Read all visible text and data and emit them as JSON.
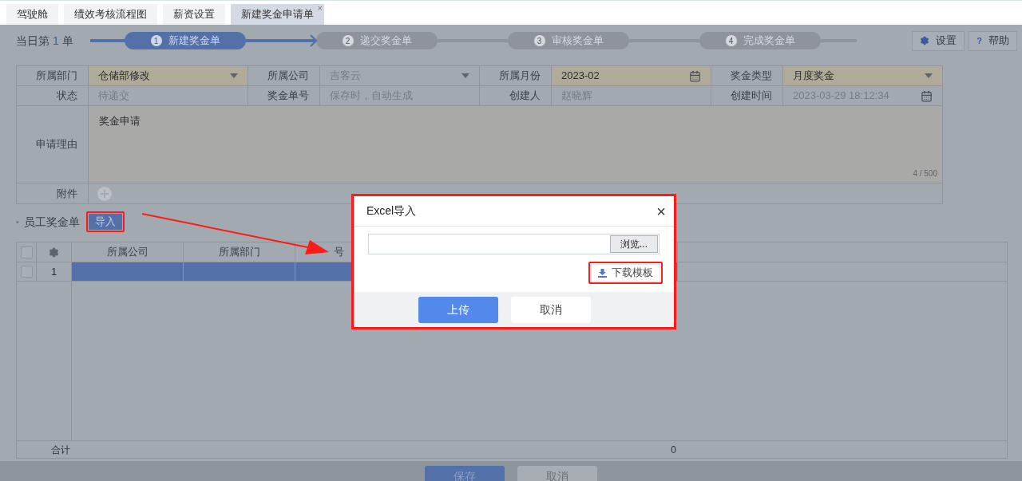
{
  "tabs": [
    {
      "label": "驾驶舱",
      "selected": false
    },
    {
      "label": "绩效考核流程图",
      "selected": false
    },
    {
      "label": "薪资设置",
      "selected": false
    },
    {
      "label": "新建奖金申请单",
      "selected": true,
      "close_mark": "×"
    }
  ],
  "counter": {
    "prefix": "当日第",
    "count": "1",
    "suffix": "单"
  },
  "steps": [
    {
      "number": "1",
      "label": "新建奖金单",
      "selected": true
    },
    {
      "number": "2",
      "label": "递交奖金单",
      "selected": false
    },
    {
      "number": "3",
      "label": "审核奖金单",
      "selected": false
    },
    {
      "number": "4",
      "label": "完成奖金单",
      "selected": false
    }
  ],
  "actions": [
    {
      "kind": "settings",
      "label": "设置"
    },
    {
      "kind": "help",
      "glyph": "?",
      "label": "帮助"
    }
  ],
  "form": {
    "rows": [
      [
        {
          "label": "所属部门",
          "value": "仓储部修改",
          "kind": "select",
          "disabled": false
        },
        {
          "label": "所属公司",
          "value": "吉客云",
          "kind": "select",
          "disabled": true
        },
        {
          "label": "所属月份",
          "value": "2023-02",
          "kind": "date",
          "disabled": false
        },
        {
          "label": "奖金类型",
          "value": "月度奖金",
          "kind": "select",
          "disabled": false
        }
      ],
      [
        {
          "label": "状态",
          "value": "待递交",
          "kind": "text",
          "disabled": true
        },
        {
          "label": "奖金单号",
          "placeholder": "保存时，自动生成",
          "kind": "text",
          "disabled": true
        },
        {
          "label": "创建人",
          "value": "赵晓辉",
          "kind": "text",
          "disabled": true
        },
        {
          "label": "创建时间",
          "value": "2023-03-29 18:12:34",
          "kind": "date",
          "disabled": true
        }
      ]
    ],
    "reason": {
      "label": "申请理由",
      "value": "奖金申请",
      "counter": "4 / 500"
    },
    "attachment": {
      "label": "附件"
    }
  },
  "section": {
    "bullet": "•",
    "title": "员工奖金单",
    "import_button": "导入"
  },
  "grid": {
    "all_checked": false,
    "columns": [
      "所属公司",
      "所属部门",
      "号"
    ],
    "rows": [
      {
        "index": "1",
        "selected": true,
        "checked": false
      }
    ],
    "total_label": "合计",
    "total_value": "0"
  },
  "footer": {
    "buttons": [
      {
        "label": "保存",
        "kind": "primary"
      },
      {
        "label": "取消",
        "kind": "default"
      }
    ]
  },
  "dialog": {
    "title": "Excel导入",
    "close": "×",
    "browse": "浏览...",
    "download": "下载模板",
    "buttons": [
      {
        "label": "上传",
        "kind": "primary"
      },
      {
        "label": "取消",
        "kind": "default"
      }
    ]
  }
}
